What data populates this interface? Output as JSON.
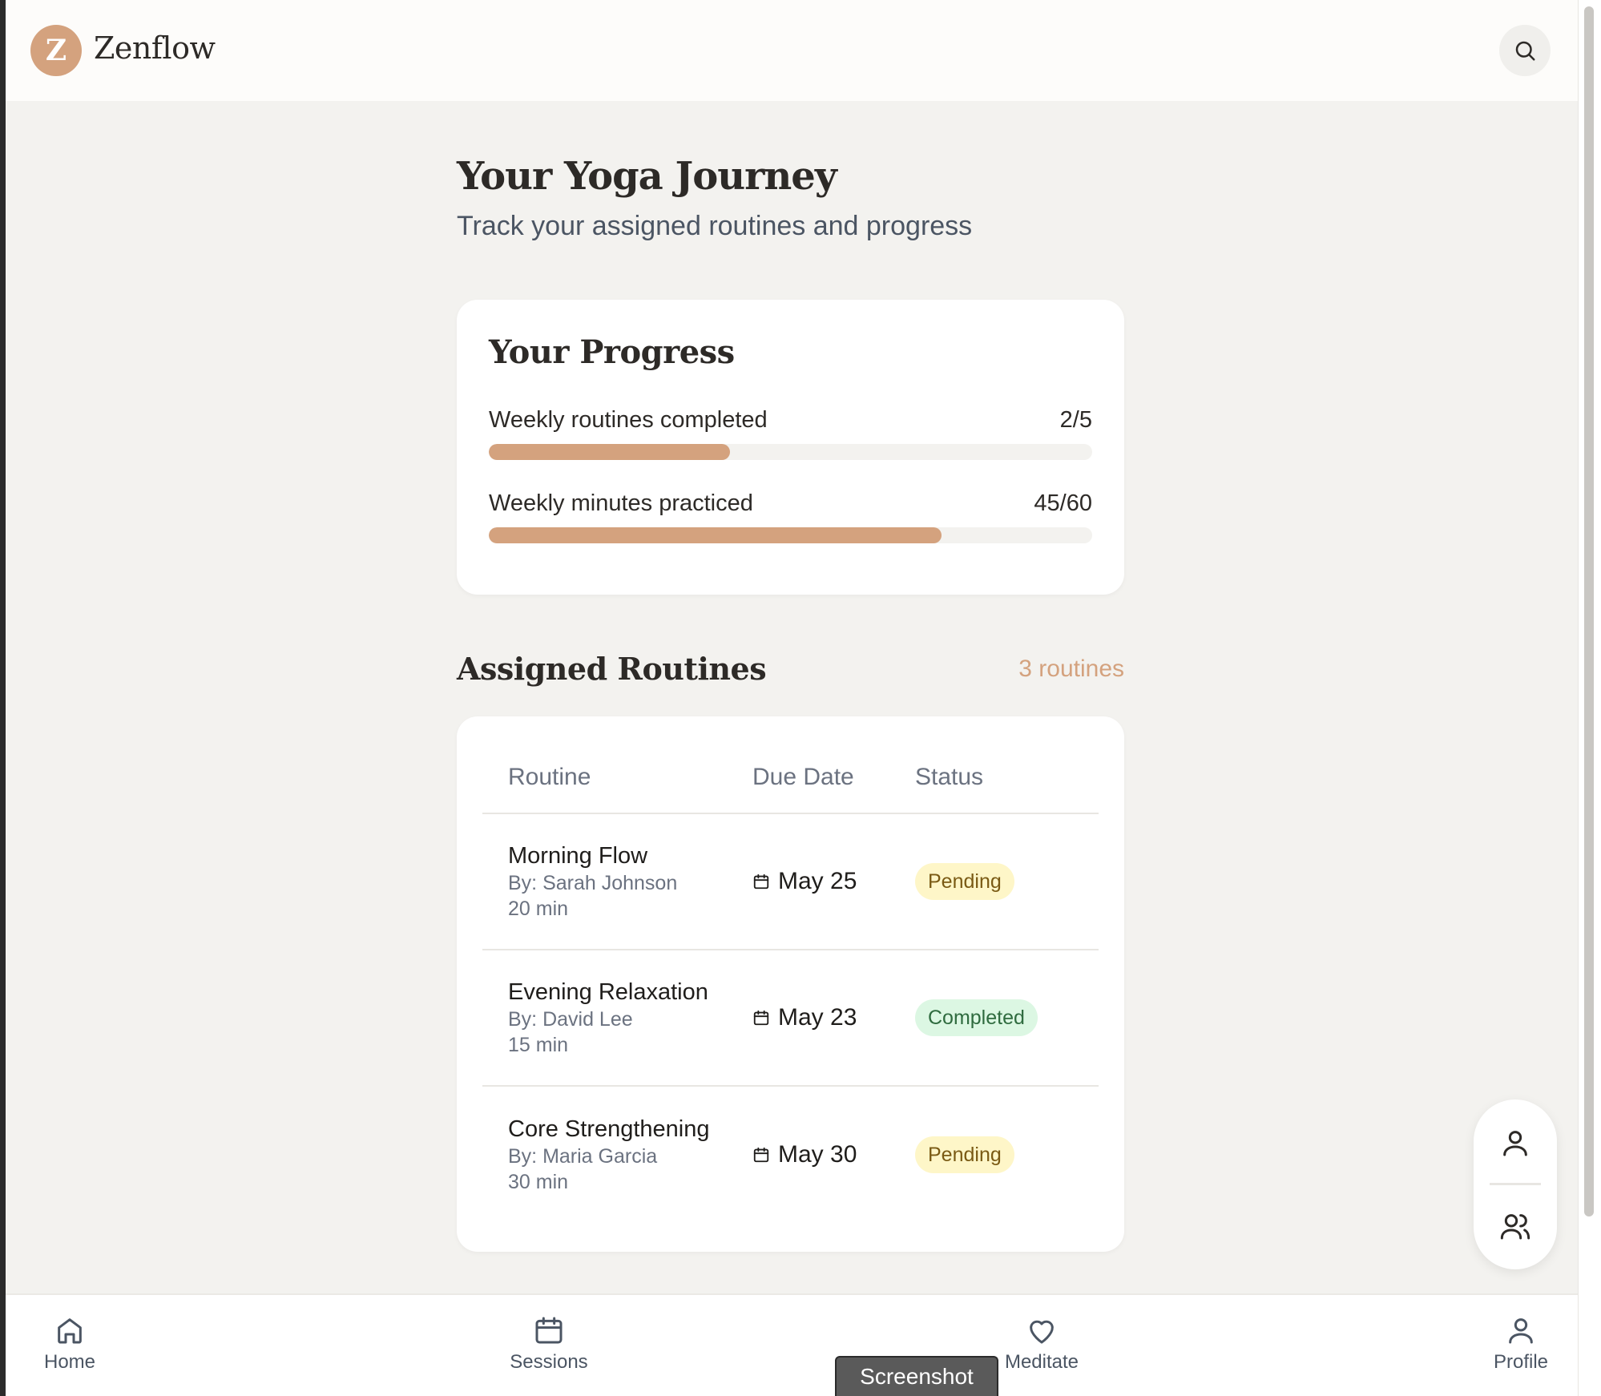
{
  "brand": {
    "logo_letter": "Z",
    "name": "Zenflow"
  },
  "header": {
    "search_icon": "search-icon"
  },
  "page": {
    "title": "Your Yoga Journey",
    "subtitle": "Track your assigned routines and progress"
  },
  "progress": {
    "title": "Your Progress",
    "items": [
      {
        "label": "Weekly routines completed",
        "value": "2/5",
        "fraction": 0.4
      },
      {
        "label": "Weekly minutes practiced",
        "value": "45/60",
        "fraction": 0.75
      }
    ]
  },
  "routines": {
    "title": "Assigned Routines",
    "count": "3 routines",
    "headers": {
      "routine": "Routine",
      "due": "Due Date",
      "status": "Status"
    },
    "rows": [
      {
        "name": "Morning Flow",
        "by": "By: Sarah Johnson",
        "duration": "20 min",
        "due": "May 25",
        "status": "Pending",
        "status_kind": "pending"
      },
      {
        "name": "Evening Relaxation",
        "by": "By: David Lee",
        "duration": "15 min",
        "due": "May 23",
        "status": "Completed",
        "status_kind": "completed"
      },
      {
        "name": "Core Strengthening",
        "by": "By: Maria Garcia",
        "duration": "30 min",
        "due": "May 30",
        "status": "Pending",
        "status_kind": "pending"
      }
    ]
  },
  "bottom_nav": {
    "items": [
      {
        "label": "Home",
        "icon": "home-icon"
      },
      {
        "label": "Sessions",
        "icon": "calendar-icon"
      },
      {
        "label": "Meditate",
        "icon": "heart-icon"
      },
      {
        "label": "Profile",
        "icon": "user-icon"
      }
    ]
  },
  "toast": {
    "label": "Screenshot"
  },
  "colors": {
    "accent": "#d4a27e",
    "background": "#f3f2ef",
    "pending_bg": "#fef6c8",
    "completed_bg": "#dcf7e3"
  }
}
